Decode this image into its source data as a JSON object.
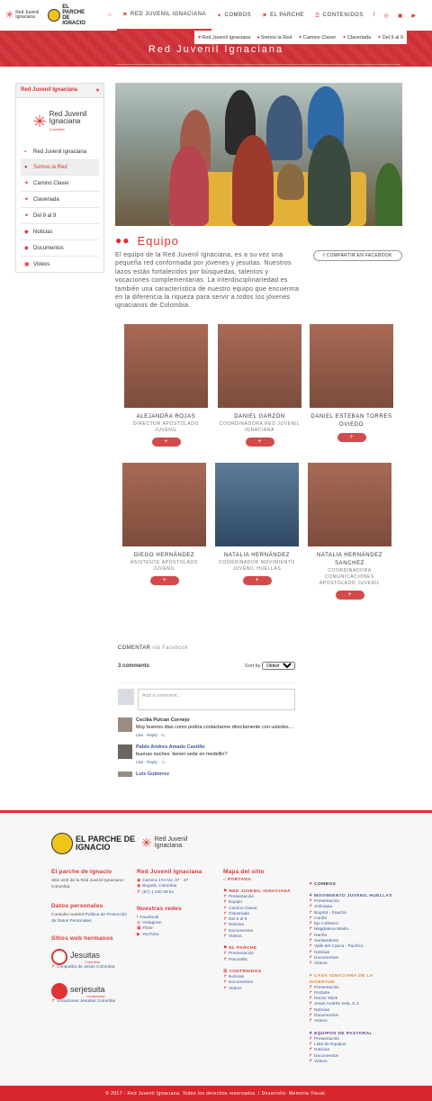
{
  "header": {
    "logo1_text": "Red Juvenil Ignaciana",
    "logo2_text": "EL PARCHE DE IGNACIO",
    "nav": [
      {
        "label": "Red Juvenil Ignaciana",
        "icon": "flag-icon"
      },
      {
        "label": "Combos",
        "icon": "star-icon"
      },
      {
        "label": "El Parche",
        "icon": "flag-icon"
      },
      {
        "label": "Contenidos",
        "icon": "list-icon"
      }
    ],
    "social": [
      "f",
      "◎",
      "▣",
      "▶"
    ]
  },
  "subnav": [
    "Red Juvenil Ignaciana",
    "Somos la Red",
    "Camino Claver",
    "Claveriada",
    "Del 9 al 9"
  ],
  "banner_title": "Red Juvenil Ignaciana",
  "sidebar": {
    "heading": "Red Juvenil Ignaciana",
    "logo_text1": "Red Juvenil",
    "logo_text2": "Ignaciana",
    "logo_sub": "Colombia",
    "items": [
      {
        "label": "Red Juvenil Ignaciana",
        "icon": "▪"
      },
      {
        "label": "Somos la Red",
        "icon": "●"
      },
      {
        "label": "Camino Claver",
        "icon": "✦"
      },
      {
        "label": "Claveriada",
        "icon": "✦"
      },
      {
        "label": "Del 9 al 9",
        "icon": "✦"
      },
      {
        "label": "Noticias",
        "icon": "◆"
      },
      {
        "label": "Documentos",
        "icon": "◆"
      },
      {
        "label": "Videos",
        "icon": "▣"
      }
    ]
  },
  "team": {
    "title": "Equipo",
    "description": "El equipo de la Red Juvenil Ignaciana, es a su vez una pequeña red conformada por jóvenes y jesuitas. Nuestros lazos están fortalecidos por búsquedas, talentos y vocaciones complementarias. La interdisciplinariedad es también una característica de nuestro equipo que encuentra en la diferencia la riqueza para servir a todos los jóvenes ignacianos de Colombia.",
    "share": "COMPARTIR EN FACEBOOK",
    "members": [
      {
        "name": "ALEJANDRA ROJAS",
        "role": "DIRECTOR APOSTOLADO JUVENIL"
      },
      {
        "name": "DANIEL GARZÓN",
        "role": "COORDINADORA RED JUVENIL IGNACIANA"
      },
      {
        "name": "DANIEL ESTEBAN TORRES OVIEDO",
        "role": ""
      },
      {
        "name": "DIEGO HERNÁNDEZ",
        "role": "ASISTENTE APOSTOLADO JUVENIL"
      },
      {
        "name": "NATALIA HERNÁNDEZ",
        "role": "COORDINADOR MOVIMIENTO JUVENIL HUELLAS"
      },
      {
        "name": "NATALIA HERNÁNDEZ SANCHEZ",
        "role": "COORDINADORA COMUNICACIONES APOSTOLADO JUVENIL"
      }
    ],
    "plus": "+"
  },
  "comments": {
    "heading": "COMENTAR",
    "heading_sub": "vía Facebook",
    "count": "3 comments",
    "sort_label": "Sort by",
    "sort_value": "Oldest",
    "placeholder": "Add a comment...",
    "items": [
      {
        "name": "Cecilia Pulcan Cornejo",
        "text": "Muy buenos dias como podria contactarme directamente con ustedes....",
        "actions": "Like · Reply ·",
        "time": "6y"
      },
      {
        "name": "Pablo Andres Amado Castillo",
        "text": "buenas noches. tienen sede en medellin?",
        "actions": "Like · Reply ·",
        "time": "7y"
      },
      {
        "name": "Luis Gutierrez",
        "text": "",
        "actions": "",
        "time": ""
      }
    ]
  },
  "footer": {
    "logo1": "EL PARCHE DE IGNACIO",
    "logo2": "Red Juvenil Ignaciana",
    "col1": {
      "h1": "El parche de Ignacio",
      "t1": "Sitio web de la Red Juvenil Ignaciana - Colombia.",
      "h2": "Datos personales",
      "t2a": "Consulta nuestra",
      "t2b": "Política de Protección de Datos Personales.",
      "h3": "Sitios web hermanos",
      "b1": "Jesuitas",
      "b1sub": "Colombia",
      "l1": "Compañía de Jesús Colombia",
      "b2": "serjesuita",
      "b2sub": "Vocacionas",
      "l2": "Vocaciones Jesuitas Colombia"
    },
    "col2": {
      "h1": "Red Juvenil Ignaciana",
      "lines": [
        "Carrera 17A No. 37 - 47",
        "Bogotá, Colombia",
        "(57) 1 340 09 81"
      ],
      "h2": "Nuestras redes",
      "social": [
        "Facebook",
        "Instagram",
        "Flickr",
        "YouTube"
      ]
    },
    "col3": {
      "h1": "Mapa del sitio",
      "portada": "PORTADA",
      "s1": "RED JUVENIL IGNACIANA",
      "s1items": [
        "Presentación",
        "Equipo",
        "Camino Claver",
        "Claveriada",
        "Del 9 al 9",
        "Noticias",
        "Documentos",
        "Videos"
      ],
      "s2": "EL PARCHE",
      "s2items": [
        "Presentación",
        "ParcerBls"
      ],
      "s3": "CONTENIDOS",
      "s3items": [
        "Noticias",
        "Documentos",
        "Videos"
      ]
    },
    "col4": {
      "h1": "COMBOS",
      "s1": "MOVIMIENTO JUVENIL HUELLAS",
      "s1items": [
        "Presentación",
        "Antioquia",
        "Bogotá - Soacha",
        "Caribe",
        "Eje Cafetero",
        "Magdalena Medio",
        "Nariño",
        "Santanderes",
        "Valle del Cauca - Pacífico",
        "Noticias",
        "Documentos",
        "Videos"
      ],
      "s2": "CASA IGNACIANA DE LA JUVENTUD",
      "s2items": [
        "Presentación",
        "PAZarte",
        "Noche Taizé",
        "Jesús Andrés Vela, S.J.",
        "Noticias",
        "Documentos",
        "Videos"
      ],
      "s3": "EQUIPOS DE PASTORAL",
      "s3items": [
        "Presentación",
        "Lista de Equipos",
        "Noticias",
        "Documentos",
        "Videos"
      ]
    }
  },
  "copyright": "© 2017 - Red Juvenil Ignaciana. Todos los derechos reservados.  I  Desarrollo: Memoria Visual."
}
